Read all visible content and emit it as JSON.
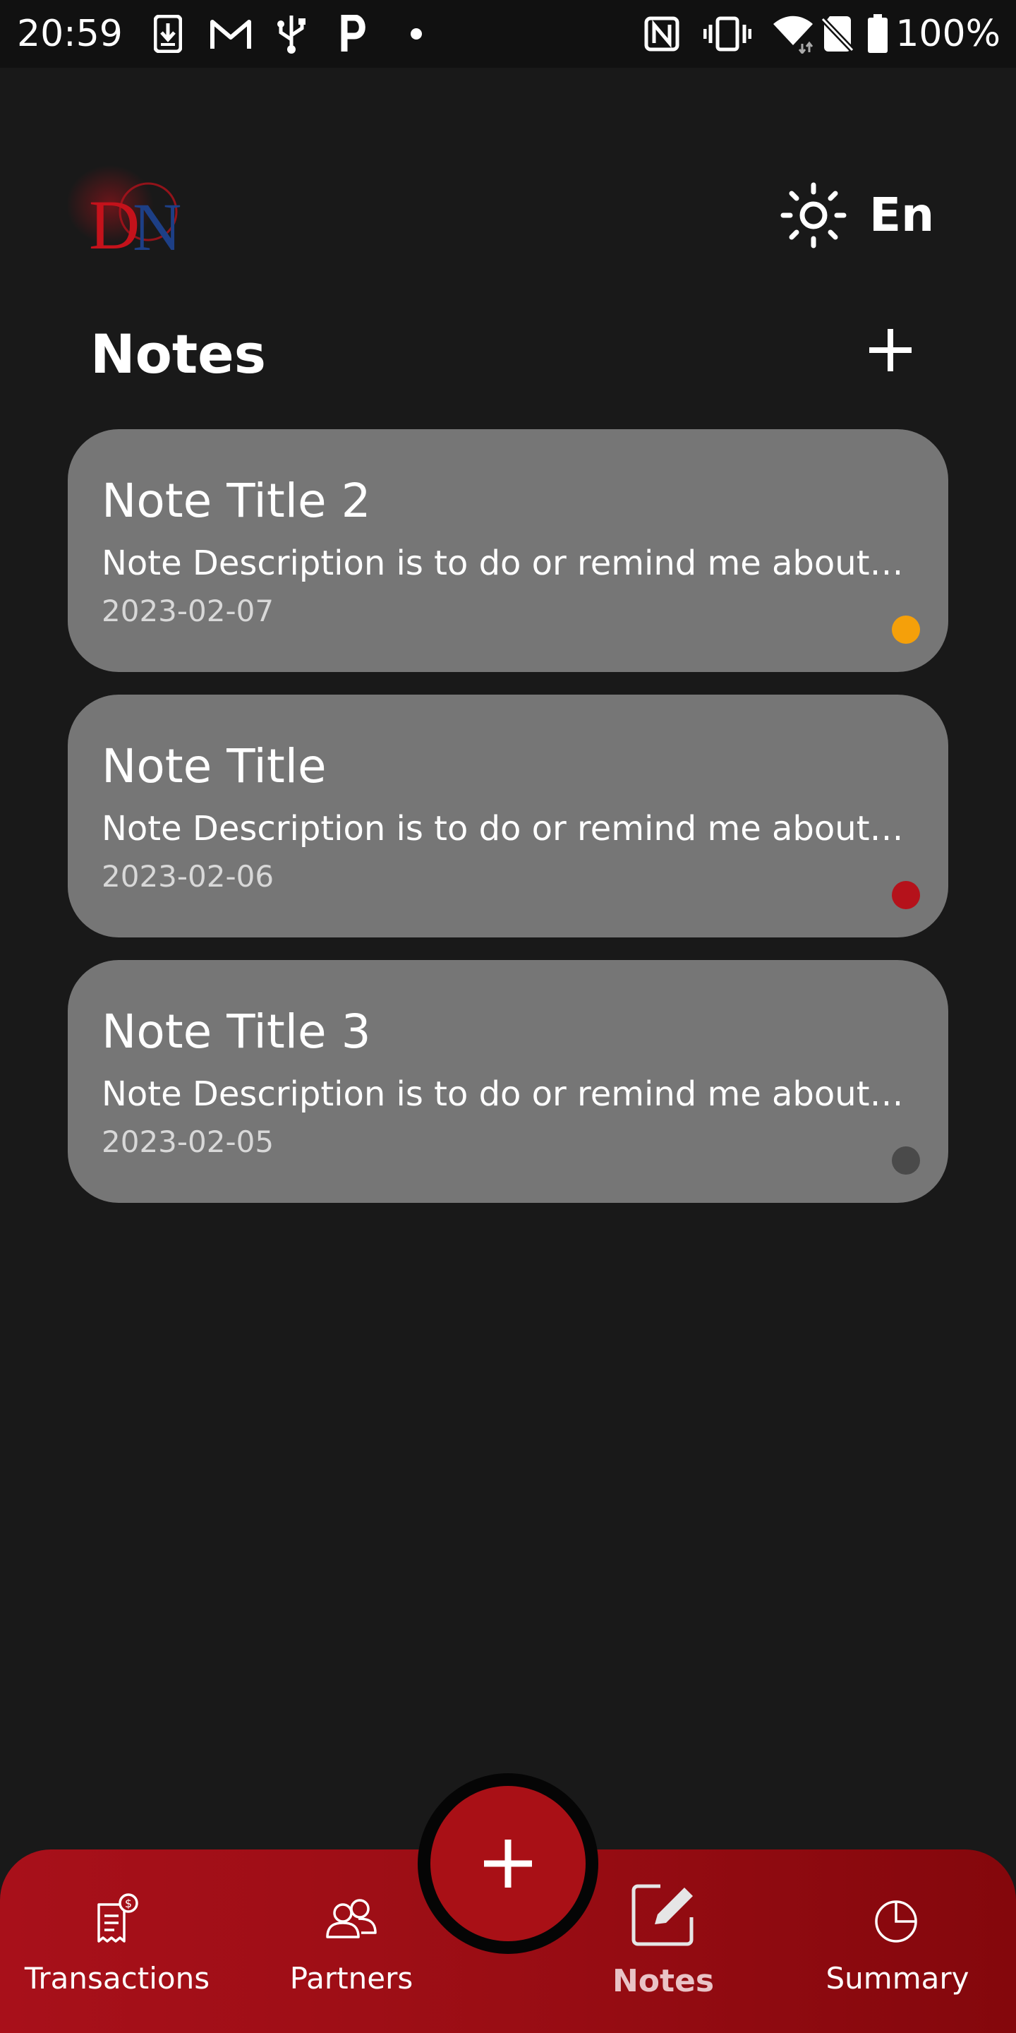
{
  "status_bar": {
    "time": "20:59",
    "battery": "100%",
    "left_icons": [
      "download-icon",
      "gmail-icon",
      "usb-icon",
      "parking-icon",
      "dot-icon"
    ],
    "right_icons": [
      "nfc-icon",
      "vibrate-icon",
      "wifi-icon",
      "no-sim-icon",
      "battery-icon"
    ]
  },
  "header": {
    "logo_text": "DN",
    "theme_icon": "sun-icon",
    "language": "En"
  },
  "page": {
    "title": "Notes",
    "add_icon": "plus-icon"
  },
  "notes": [
    {
      "title": "Note Title 2",
      "description": "Note Description is to do or remind me about something in the future",
      "date": "2023-02-07",
      "color": "#f5a00a"
    },
    {
      "title": "Note Title",
      "description": "Note Description is to do or remind me about something in the future",
      "date": "2023-02-06",
      "color": "#b5121b"
    },
    {
      "title": "Note Title 3",
      "description": "Note Description is to do or remind me about something in the future",
      "date": "2023-02-05",
      "color": "#4a4a4a"
    }
  ],
  "bottom_nav": {
    "items": [
      {
        "label": "Transactions",
        "icon": "receipt-icon"
      },
      {
        "label": "Partners",
        "icon": "partners-icon"
      },
      {
        "label": "Notes",
        "icon": "edit-note-icon",
        "active": true
      },
      {
        "label": "Summary",
        "icon": "pie-chart-icon"
      }
    ],
    "fab_icon": "plus-icon"
  },
  "colors": {
    "background": "#191919",
    "card": "#767676",
    "accent": "#a91016"
  }
}
